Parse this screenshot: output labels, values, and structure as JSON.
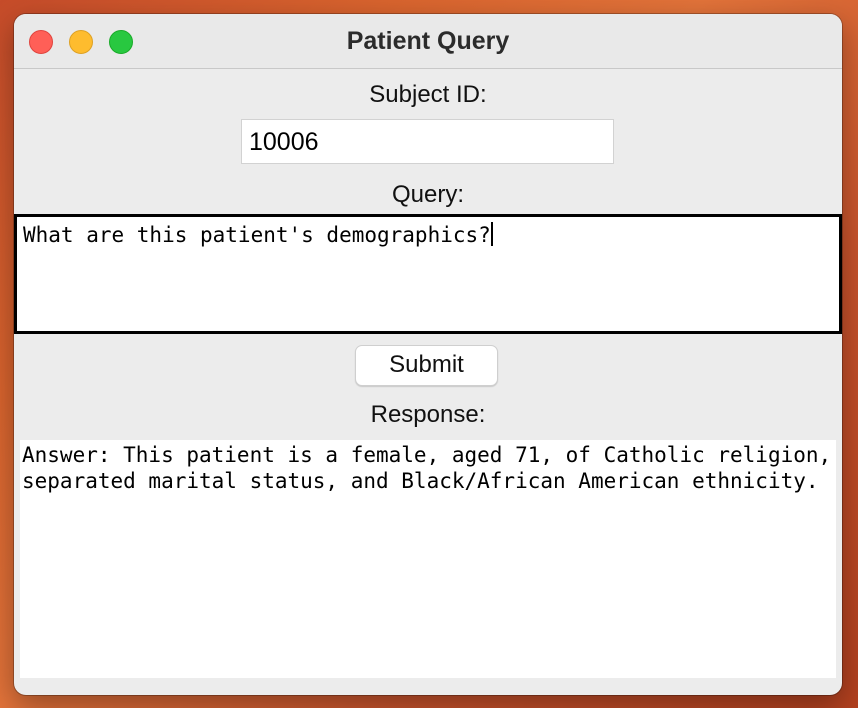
{
  "window": {
    "title": "Patient Query"
  },
  "form": {
    "subject_label": "Subject ID:",
    "subject_value": "10006",
    "query_label": "Query:",
    "query_value": "What are this patient's demographics?",
    "submit_label": "Submit",
    "response_label": "Response:",
    "response_value": "Answer: This patient is a female, aged 71, of Catholic religion, separated marital status, and Black/African American ethnicity."
  },
  "colors": {
    "close": "#ff5f57",
    "minimize": "#febc2e",
    "zoom": "#28c840",
    "window_background": "#ececec"
  },
  "icons": {
    "close": "close-icon",
    "minimize": "minimize-icon",
    "zoom": "zoom-icon"
  }
}
